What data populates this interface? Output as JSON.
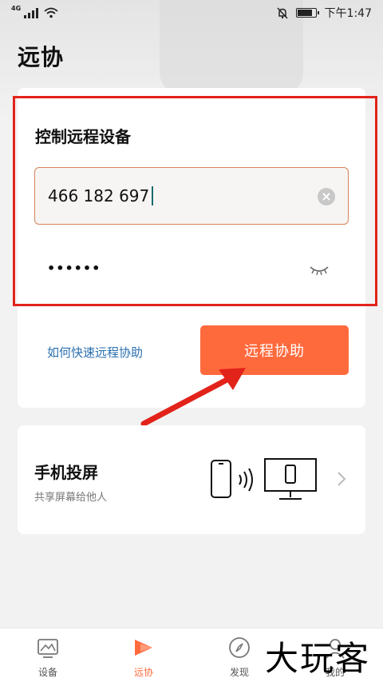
{
  "status_bar": {
    "network": "4G",
    "time": "下午1:47"
  },
  "page": {
    "title": "远协"
  },
  "remote_control": {
    "title": "控制远程设备",
    "device_id": "466 182 697",
    "password_masked": "••••••",
    "help_link": "如何快速远程协助",
    "assist_button": "远程协助"
  },
  "screen_cast": {
    "title": "手机投屏",
    "subtitle": "共享屏幕给他人"
  },
  "tabbar": {
    "items": [
      {
        "label": "设备",
        "icon": "device-icon"
      },
      {
        "label": "远协",
        "icon": "remote-assist-icon",
        "active": true
      },
      {
        "label": "发现",
        "icon": "compass-icon"
      },
      {
        "label": "我的",
        "icon": "profile-icon"
      }
    ]
  },
  "watermark": {
    "text": "大玩客"
  },
  "colors": {
    "accent": "#ff6a3d",
    "link": "#2a6fb0",
    "highlight_border": "#e2231a"
  }
}
